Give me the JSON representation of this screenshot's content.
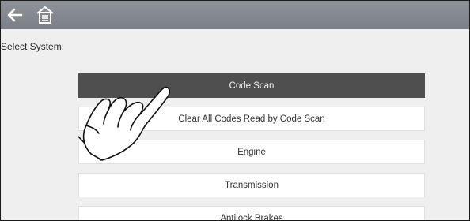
{
  "toolbar": {
    "back_icon": "back-arrow-icon",
    "home_icon": "home-icon"
  },
  "prompt": "Select System:",
  "systems": [
    {
      "label": "Code Scan",
      "selected": true
    },
    {
      "label": "Clear All Codes Read by Code Scan",
      "selected": false
    },
    {
      "label": "Engine",
      "selected": false
    },
    {
      "label": "Transmission",
      "selected": false
    },
    {
      "label": "Antilock Brakes",
      "selected": false
    }
  ],
  "colors": {
    "toolbar": "#858a90",
    "selected_item": "#4f4f4f",
    "item": "#ffffff",
    "background": "#efefef"
  },
  "overlay_icon": "pointing-hand-icon"
}
